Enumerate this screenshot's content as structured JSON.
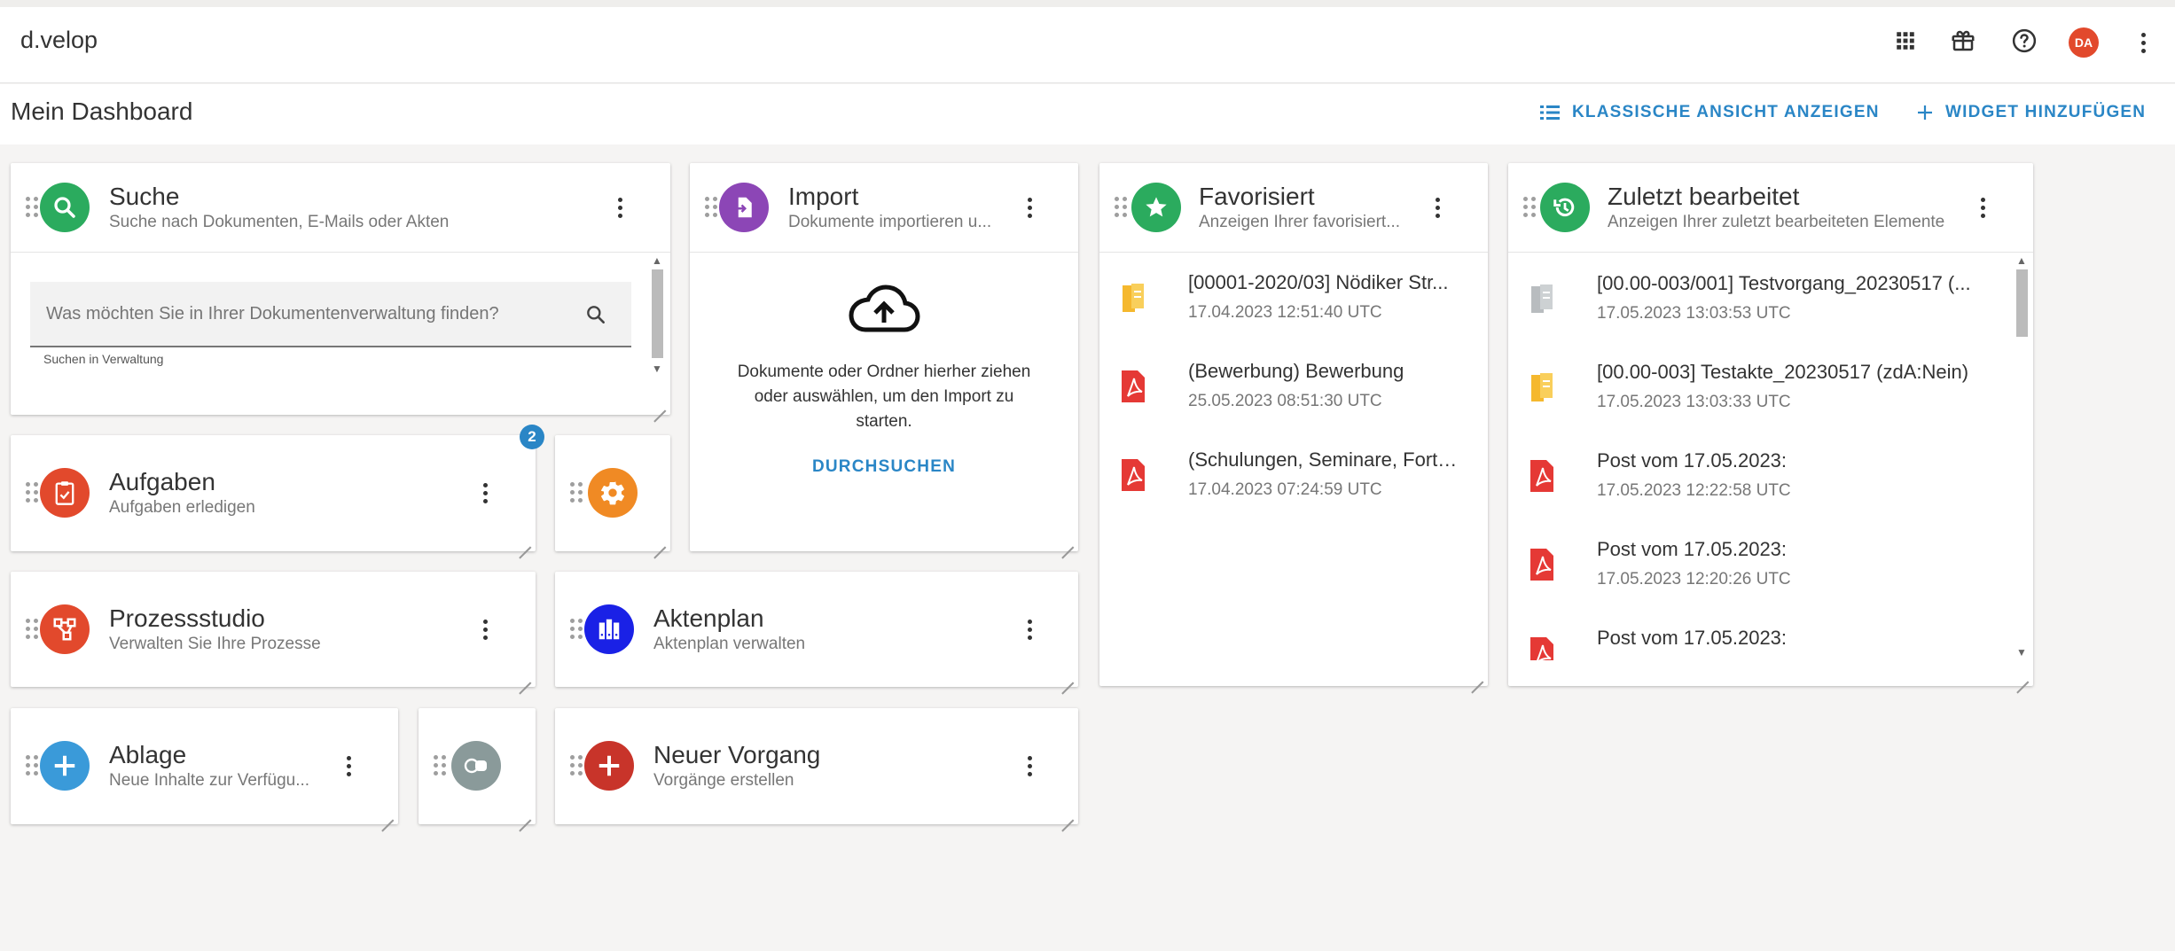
{
  "app": {
    "brand": "d.velop"
  },
  "topbar": {
    "avatar_initials": "DA"
  },
  "page": {
    "title": "Mein Dashboard",
    "classic_view_label": "KLASSISCHE ANSICHT ANZEIGEN",
    "add_widget_label": "WIDGET HINZUFÜGEN"
  },
  "colors": {
    "accent": "#2a86c6",
    "search": "#2bab5e",
    "import": "#8c46b6",
    "tasks": "#e2492c",
    "settings": "#f08a24",
    "process": "#e2492c",
    "fileplan": "#1a21e6",
    "storage": "#3a9ad9",
    "link": "#8a9a9a",
    "newcase": "#c8342a",
    "pdf": "#e53935",
    "folder": "#f5b82e"
  },
  "widgets": {
    "search": {
      "title": "Suche",
      "subtitle": "Suche nach Dokumenten, E-Mails oder Akten",
      "placeholder": "Was möchten Sie in Ihrer Dokumentenverwaltung finden?",
      "hint": "Suchen in Verwaltung"
    },
    "import": {
      "title": "Import",
      "subtitle": "Dokumente importieren u...",
      "drop_text_1": "Dokumente oder Ordner hierher ziehen",
      "drop_text_2": "oder auswählen, um den Import zu",
      "drop_text_3": "starten.",
      "browse_label": "DURCHSUCHEN"
    },
    "favorites": {
      "title": "Favorisiert",
      "subtitle": "Anzeigen Ihrer favorisiert...",
      "items": [
        {
          "icon": "folder",
          "title": "[00001-2020/03] Nödiker Str...",
          "date": "17.04.2023 12:51:40 UTC"
        },
        {
          "icon": "pdf",
          "title": "(Bewerbung) Bewerbung",
          "date": "25.05.2023 08:51:30 UTC"
        },
        {
          "icon": "pdf",
          "title": "(Schulungen, Seminare, Fortb...",
          "date": "17.04.2023 07:24:59 UTC"
        }
      ]
    },
    "recent": {
      "title": "Zuletzt bearbeitet",
      "subtitle": "Anzeigen Ihrer zuletzt bearbeiteten Elemente",
      "items": [
        {
          "icon": "folder-grey",
          "title": "[00.00-003/001] Testvorgang_20230517 (...",
          "date": "17.05.2023 13:03:53 UTC"
        },
        {
          "icon": "folder",
          "title": "[00.00-003] Testakte_20230517 (zdA:Nein)",
          "date": "17.05.2023 13:03:33 UTC"
        },
        {
          "icon": "pdf",
          "title": "Post vom 17.05.2023:",
          "date": "17.05.2023 12:22:58 UTC"
        },
        {
          "icon": "pdf",
          "title": "Post vom 17.05.2023:",
          "date": "17.05.2023 12:20:26 UTC"
        },
        {
          "icon": "pdf",
          "title": "Post vom 17.05.2023:",
          "date": ""
        }
      ]
    },
    "tasks": {
      "title": "Aufgaben",
      "subtitle": "Aufgaben erledigen",
      "badge": "2"
    },
    "process": {
      "title": "Prozessstudio",
      "subtitle": "Verwalten Sie Ihre Prozesse"
    },
    "fileplan": {
      "title": "Aktenplan",
      "subtitle": "Aktenplan verwalten"
    },
    "storage": {
      "title": "Ablage",
      "subtitle": "Neue Inhalte zur Verfügu..."
    },
    "newcase": {
      "title": "Neuer Vorgang",
      "subtitle": "Vorgänge erstellen"
    }
  }
}
